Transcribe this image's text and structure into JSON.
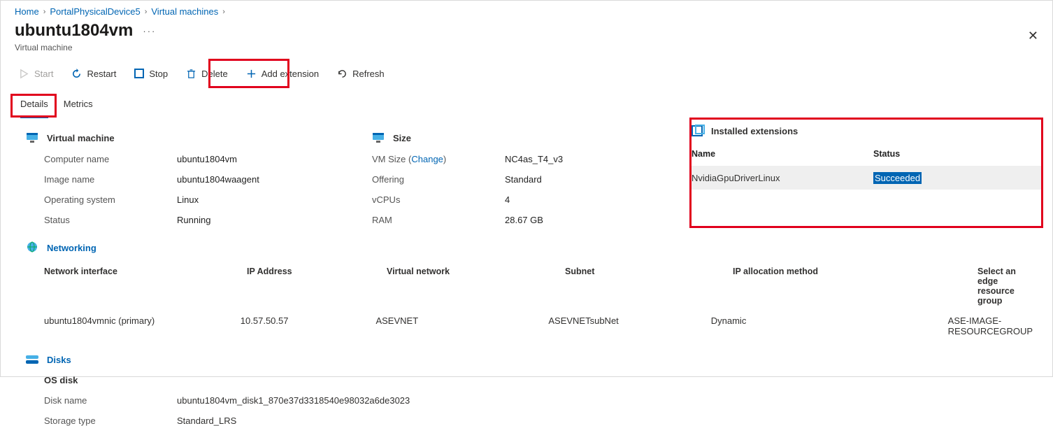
{
  "breadcrumbs": {
    "home": "Home",
    "device": "PortalPhysicalDevice5",
    "vms": "Virtual machines"
  },
  "header": {
    "title": "ubuntu1804vm",
    "subtitle": "Virtual machine"
  },
  "toolbar": {
    "start": "Start",
    "restart": "Restart",
    "stop": "Stop",
    "delete": "Delete",
    "add_extension": "Add extension",
    "refresh": "Refresh"
  },
  "tabs": {
    "details": "Details",
    "metrics": "Metrics"
  },
  "vm_section": {
    "title": "Virtual machine",
    "fields": {
      "computer_name_k": "Computer name",
      "computer_name_v": "ubuntu1804vm",
      "image_name_k": "Image name",
      "image_name_v": "ubuntu1804waagent",
      "os_k": "Operating system",
      "os_v": "Linux",
      "status_k": "Status",
      "status_v": "Running"
    }
  },
  "size_section": {
    "title": "Size",
    "fields": {
      "vmsize_k": "VM Size",
      "vmsize_change": "Change",
      "vmsize_v": "NC4as_T4_v3",
      "offering_k": "Offering",
      "offering_v": "Standard",
      "vcpus_k": "vCPUs",
      "vcpus_v": "4",
      "ram_k": "RAM",
      "ram_v": "28.67 GB"
    }
  },
  "extensions": {
    "title": "Installed extensions",
    "col_name": "Name",
    "col_status": "Status",
    "rows": [
      {
        "name": "NvidiaGpuDriverLinux",
        "status": "Succeeded"
      }
    ]
  },
  "networking": {
    "title": "Networking",
    "headers": {
      "iface": "Network interface",
      "ip": "IP Address",
      "vnet": "Virtual network",
      "subnet": "Subnet",
      "method": "IP allocation method",
      "rg": "Select an edge resource group"
    },
    "row": {
      "iface": "ubuntu1804vmnic (primary)",
      "ip": "10.57.50.57",
      "vnet": "ASEVNET",
      "subnet": "ASEVNETsubNet",
      "method": "Dynamic",
      "rg": "ASE-IMAGE-RESOURCEGROUP"
    }
  },
  "disks": {
    "title": "Disks",
    "os_disk": "OS disk",
    "name_k": "Disk name",
    "name_v": "ubuntu1804vm_disk1_870e37d3318540e98032a6de3023",
    "type_k": "Storage type",
    "type_v": "Standard_LRS"
  }
}
